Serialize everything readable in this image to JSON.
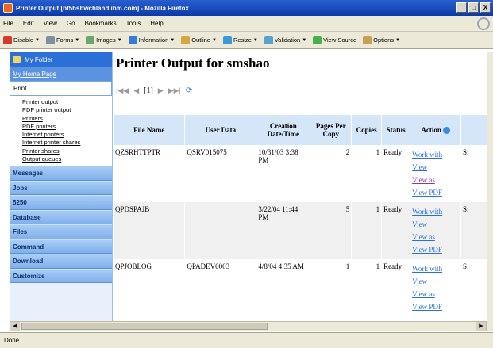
{
  "window": {
    "title": "Printer Output [bf5hsbwchland.ibm.com] - Mozilla Firefox",
    "minimize": "_",
    "maximize": "□",
    "close": "X"
  },
  "menubar": [
    "File",
    "Edit",
    "View",
    "Go",
    "Bookmarks",
    "Tools",
    "Help"
  ],
  "toolbar": [
    {
      "label": "Disable",
      "icon": "red-x-icon",
      "color": "#d23a2a"
    },
    {
      "label": "Forms",
      "icon": "forms-icon",
      "color": "#7f8fa8"
    },
    {
      "label": "Images",
      "icon": "images-icon",
      "color": "#6ea46e"
    },
    {
      "label": "Information",
      "icon": "info-icon",
      "color": "#3a7ad8"
    },
    {
      "label": "Outline",
      "icon": "pencil-icon",
      "color": "#d8a63a"
    },
    {
      "label": "Resize",
      "icon": "resize-icon",
      "color": "#3a9ad8"
    },
    {
      "label": "Validation",
      "icon": "validation-icon",
      "color": "#5aa0d0"
    },
    {
      "label": "View Source",
      "icon": "source-icon",
      "color": "#4ab04a"
    },
    {
      "label": "Options",
      "icon": "options-icon",
      "color": "#c8a050"
    }
  ],
  "sidebar": {
    "folder": "My Folder",
    "home": "My Home Page",
    "current": "Print",
    "subitems": [
      "Printer output",
      "PDF printer output",
      "Printers",
      "PDF printers",
      "Internet printers",
      "Internet printer shares",
      "Printer shares",
      "Output queues"
    ],
    "categories": [
      "Messages",
      "Jobs",
      "5250",
      "Database",
      "Files",
      "Command",
      "Download",
      "Customize"
    ]
  },
  "content": {
    "title": "Printer Output for smshao",
    "pager": {
      "first": "|◀◀",
      "prev": "◀",
      "current": "[1]",
      "next": "▶",
      "last": "▶▶|",
      "refresh": "⟳"
    }
  },
  "table": {
    "headers": [
      "File Name",
      "User Data",
      "Creation Date/Time",
      "Pages Per Copy",
      "Copies",
      "Status",
      "Action"
    ],
    "rows": [
      {
        "file": "QZSRHTTPTR",
        "user": "QSRV015075",
        "date": "10/31/03 3:38 PM",
        "pages": "2",
        "copies": "1",
        "status": "Ready",
        "extra": "S:"
      },
      {
        "file": "QPDSPAJB",
        "user": "",
        "date": "3/22/04 11:44 PM",
        "pages": "5",
        "copies": "1",
        "status": "Ready",
        "extra": "S:"
      },
      {
        "file": "QPJOBLOG",
        "user": "QPADEV0003",
        "date": "4/8/04 4:35 AM",
        "pages": "1",
        "copies": "1",
        "status": "Ready",
        "extra": "S:"
      }
    ],
    "actions": [
      "Work with",
      "View",
      "View as",
      "View PDF"
    ]
  },
  "status": "Done",
  "colors": {
    "accent": "#2b6fd9",
    "header_bg": "#d5e6f8",
    "visited": "#8a3aa0"
  }
}
